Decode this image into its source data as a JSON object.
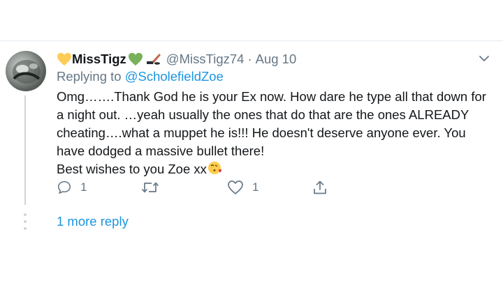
{
  "tweet": {
    "display_name": "MissTigz",
    "handle": "@MissTigz74",
    "separator": "·",
    "date": "Aug 10",
    "replying_prefix": "Replying to ",
    "replying_to": "@ScholefieldZoe",
    "body_line1": "Omg…….Thank God he is your Ex now. How dare he type all that down for a night out. …yeah usually the ones that do that are the ones ALREADY cheating….what a muppet he is!!! He doesn't deserve anyone ever. You have dodged a massive bullet there!",
    "body_line2": "Best wishes to you Zoe xx",
    "reply_count": "1",
    "retweet_count": "",
    "like_count": "1"
  },
  "thread": {
    "more_replies_label": "1 more reply"
  },
  "icons": {
    "heart_left": "yellow-heart-icon",
    "heart_right": "green-heart-icon",
    "hockey": "hockey-stick-icon",
    "kiss": "face-blowing-kiss-icon"
  },
  "colors": {
    "accent": "#1b95e0",
    "muted": "#657786",
    "text": "#14171a",
    "divider": "#e6ecf0"
  }
}
